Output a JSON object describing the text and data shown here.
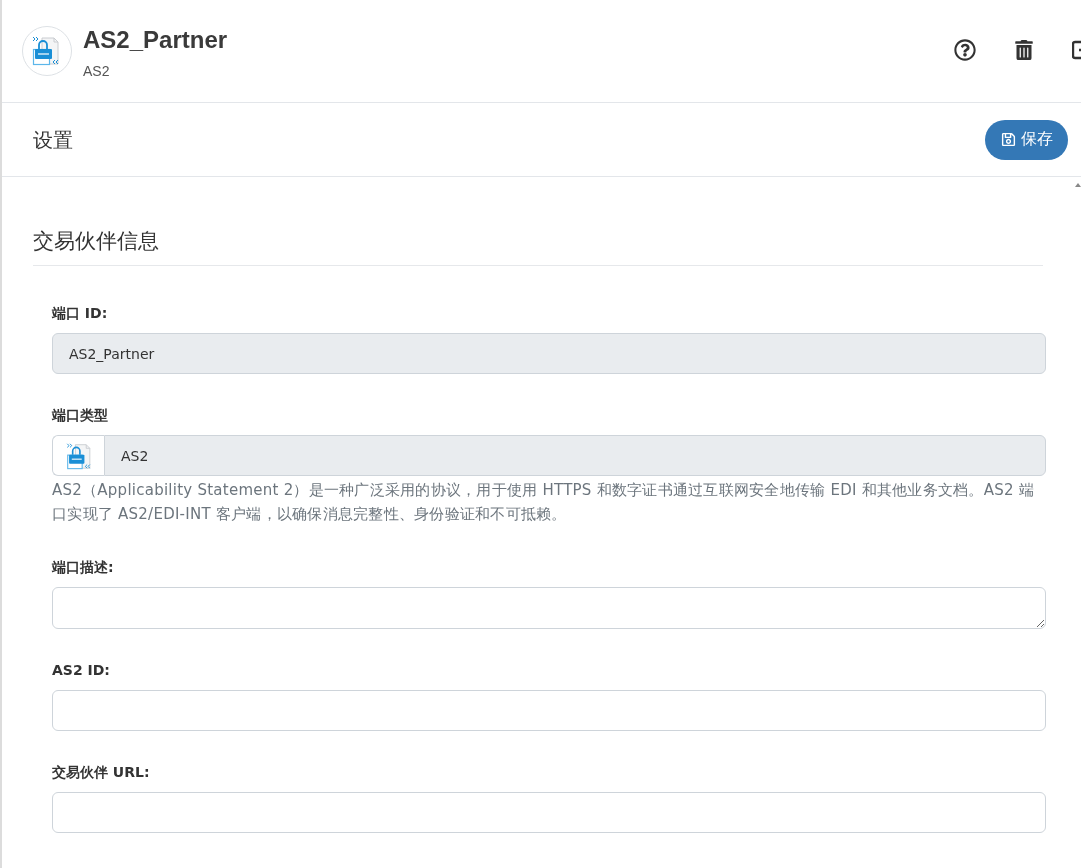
{
  "header": {
    "title": "AS2_Partner",
    "subtitle": "AS2"
  },
  "settings_bar": {
    "title": "设置",
    "save_button": "保存"
  },
  "section": {
    "title": "交易伙伴信息",
    "fields": [
      {
        "kind": "input",
        "label": "端口 ID:",
        "value": "AS2_Partner",
        "disabled": true
      },
      {
        "kind": "input_addon",
        "label": "端口类型",
        "value": "AS2",
        "disabled": true,
        "help": "AS2（Applicability Statement 2）是一种广泛采用的协议，用于使用 HTTPS 和数字证书通过互联网安全地传输 EDI 和其他业务文档。AS2 端口实现了 AS2/EDI-INT 客户端，以确保消息完整性、身份验证和不可抵赖。"
      },
      {
        "kind": "textarea",
        "label": "端口描述:",
        "disabled": false
      },
      {
        "kind": "input",
        "label": "AS2 ID:",
        "disabled": false
      },
      {
        "kind": "input",
        "label": "交易伙伴 URL:",
        "disabled": false
      }
    ]
  }
}
